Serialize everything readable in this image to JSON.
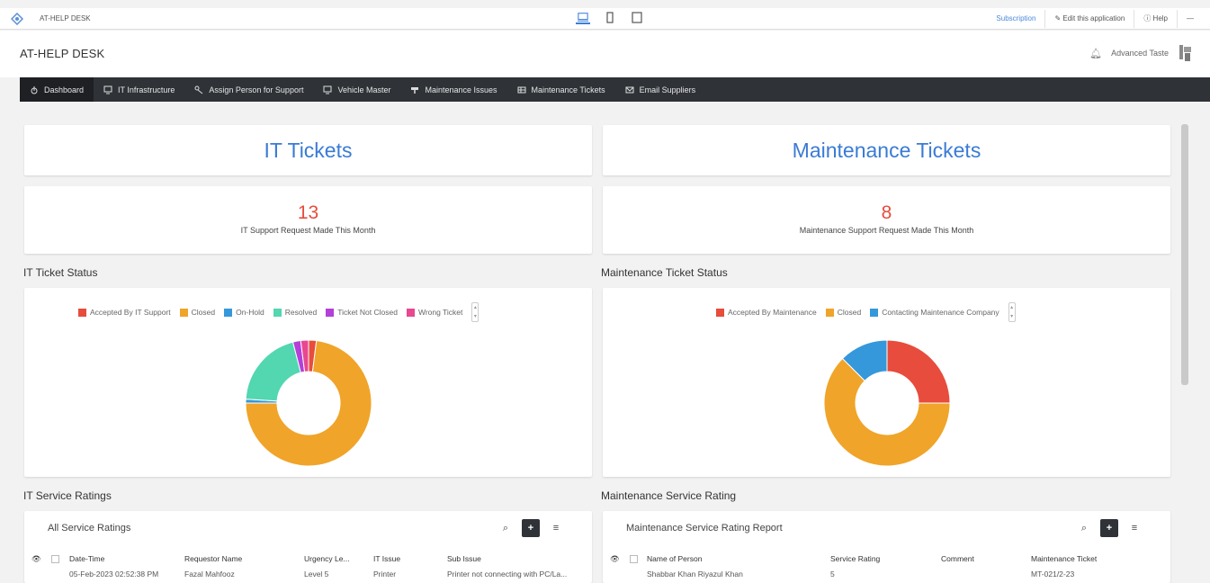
{
  "topbar": {
    "app_name": "AT-HELP DESK",
    "subscription": "Subscription",
    "edit_app": "Edit this application",
    "help": "Help",
    "more": "—"
  },
  "header": {
    "title": "AT-HELP DESK",
    "user_name": "Advanced Taste"
  },
  "nav": {
    "items": [
      {
        "label": "Dashboard",
        "icon": "dashboard-icon"
      },
      {
        "label": "IT Infrastructure",
        "icon": "monitor-icon"
      },
      {
        "label": "Assign Person for Support",
        "icon": "assign-icon"
      },
      {
        "label": "Vehicle Master",
        "icon": "monitor-icon"
      },
      {
        "label": "Maintenance Issues",
        "icon": "tools-icon"
      },
      {
        "label": "Maintenance Tickets",
        "icon": "table-icon"
      },
      {
        "label": "Email Suppliers",
        "icon": "mail-icon"
      }
    ]
  },
  "it_tickets": {
    "title": "IT Tickets",
    "count": "13",
    "count_label": "IT Support Request Made This Month"
  },
  "maint_tickets": {
    "title": "Maintenance Tickets",
    "count": "8",
    "count_label": "Maintenance Support Request Made This Month"
  },
  "it_status": {
    "section_title": "IT Ticket Status"
  },
  "maint_status": {
    "section_title": "Maintenance Ticket Status"
  },
  "chart_data": [
    {
      "type": "pie",
      "donut": true,
      "title": "IT Ticket Status",
      "legend": [
        {
          "name": "Accepted By IT Support",
          "color": "#e74c3c"
        },
        {
          "name": "Closed",
          "color": "#f0a429"
        },
        {
          "name": "On-Hold",
          "color": "#3498db"
        },
        {
          "name": "Resolved",
          "color": "#52d7b0"
        },
        {
          "name": "Ticket Not Closed",
          "color": "#b43fd9"
        },
        {
          "name": "Wrong Ticket",
          "color": "#e8488f"
        }
      ],
      "slices": [
        {
          "name": "Accepted By IT Support",
          "value": 2
        },
        {
          "name": "Closed",
          "value": 73
        },
        {
          "name": "On-Hold",
          "value": 1
        },
        {
          "name": "Resolved",
          "value": 20
        },
        {
          "name": "Ticket Not Closed",
          "value": 2
        },
        {
          "name": "Wrong Ticket",
          "value": 2
        }
      ]
    },
    {
      "type": "pie",
      "donut": true,
      "title": "Maintenance Ticket Status",
      "legend": [
        {
          "name": "Accepted By Maintenance",
          "color": "#e74c3c"
        },
        {
          "name": "Closed",
          "color": "#f0a429"
        },
        {
          "name": "Contacting Maintenance Company",
          "color": "#3498db"
        }
      ],
      "slices": [
        {
          "name": "Accepted By Maintenance",
          "value": 25
        },
        {
          "name": "Closed",
          "value": 62.5
        },
        {
          "name": "Contacting Maintenance Company",
          "value": 12.5
        }
      ]
    }
  ],
  "it_ratings": {
    "section_title": "IT Service Ratings",
    "table_title": "All Service Ratings",
    "columns": [
      "Date-Time",
      "Requestor Name",
      "Urgency Le...",
      "IT Issue",
      "Sub Issue"
    ],
    "row": [
      "05-Feb-2023 02:52:38 PM",
      "Fazal Mahfooz",
      "Level 5",
      "Printer",
      "Printer not connecting with PC/La..."
    ]
  },
  "maint_ratings": {
    "section_title": "Maintenance Service Rating",
    "table_title": "Maintenance Service Rating Report",
    "columns": [
      "Name of Person",
      "Service Rating",
      "Comment",
      "Maintenance Ticket"
    ],
    "row": [
      "Shabbar Khan Riyazul Khan",
      "5",
      "",
      "MT-021/2-23"
    ]
  }
}
